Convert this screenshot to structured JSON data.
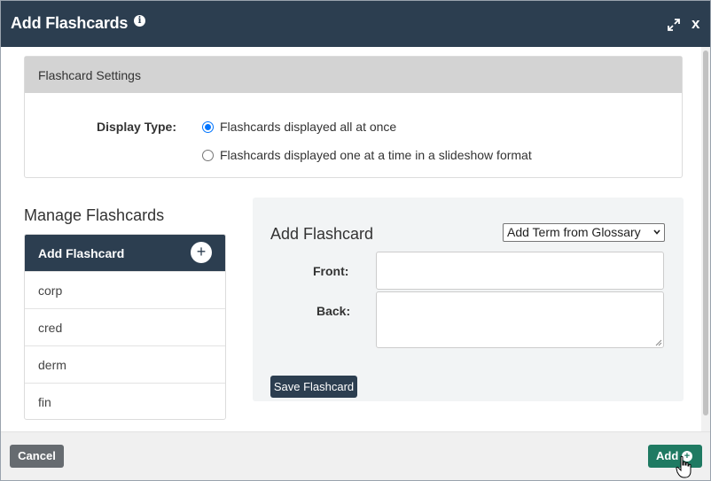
{
  "dialog": {
    "title": "Add Flashcards",
    "info_icon": "info-icon",
    "expand_icon": "expand-arrows-icon",
    "close_label": "x"
  },
  "settings": {
    "heading": "Flashcard Settings",
    "display_type_label": "Display Type:",
    "options": [
      {
        "label": "Flashcards displayed all at once",
        "selected": true
      },
      {
        "label": "Flashcards displayed one at a time in a slideshow format",
        "selected": false
      }
    ]
  },
  "manage": {
    "title": "Manage Flashcards",
    "list_header": "Add Flashcard",
    "add_icon": "plus-icon",
    "items": [
      "corp",
      "cred",
      "derm",
      "fin"
    ]
  },
  "add_flashcard": {
    "title": "Add Flashcard",
    "glossary_select_value": "Add Term from Glossary",
    "front_label": "Front:",
    "back_label": "Back:",
    "front_value": "",
    "back_value": "",
    "save_label": "Save Flashcard"
  },
  "footer": {
    "cancel_label": "Cancel",
    "add_label": "Add",
    "add_icon": "plus-circle-icon"
  },
  "colors": {
    "header": "#2c3e50",
    "accent_green": "#1f7a62",
    "cancel_gray": "#666b70",
    "radio_blue": "#0075ff"
  }
}
